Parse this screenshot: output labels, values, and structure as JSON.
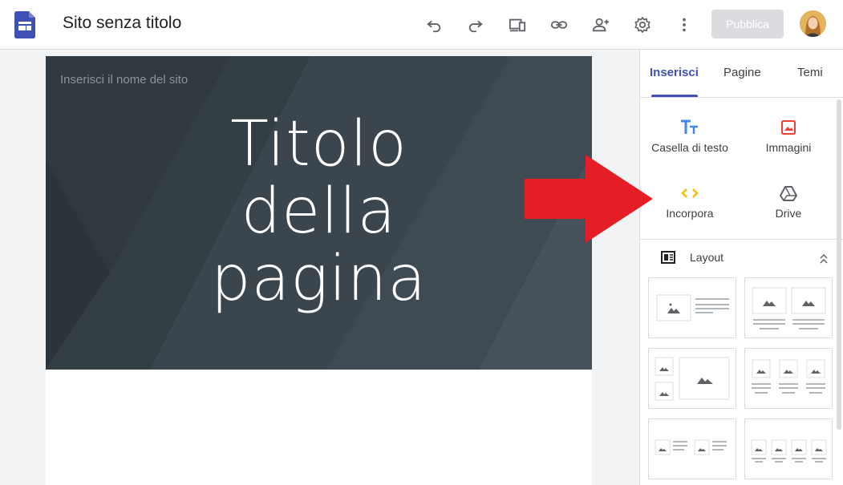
{
  "app": {
    "site_title": "Sito senza titolo",
    "publish_label": "Pubblica"
  },
  "toolbar": {
    "icons": [
      "undo-icon",
      "redo-icon",
      "preview-icon",
      "link-icon",
      "share-icon",
      "settings-icon",
      "more-icon"
    ]
  },
  "canvas": {
    "site_name_placeholder": "Inserisci il nome del sito",
    "page_title_line1": "Titolo",
    "page_title_line2": "della",
    "page_title_line3": "pagina"
  },
  "panel": {
    "tabs": [
      {
        "label": "Inserisci",
        "active": true
      },
      {
        "label": "Pagine",
        "active": false
      },
      {
        "label": "Temi",
        "active": false
      }
    ],
    "insert": [
      {
        "label": "Casella di testo",
        "icon": "text-box-icon",
        "color": "#4285f4"
      },
      {
        "label": "Immagini",
        "icon": "image-icon",
        "color": "#ea4335"
      },
      {
        "label": "Incorpora",
        "icon": "embed-icon",
        "color": "#fbbc04"
      },
      {
        "label": "Drive",
        "icon": "drive-icon",
        "color": "#5f6368"
      }
    ],
    "layout_label": "Layout"
  },
  "colors": {
    "accent": "#3f51b5",
    "arrow": "#e51d24",
    "hero_bg": "#37424a"
  }
}
